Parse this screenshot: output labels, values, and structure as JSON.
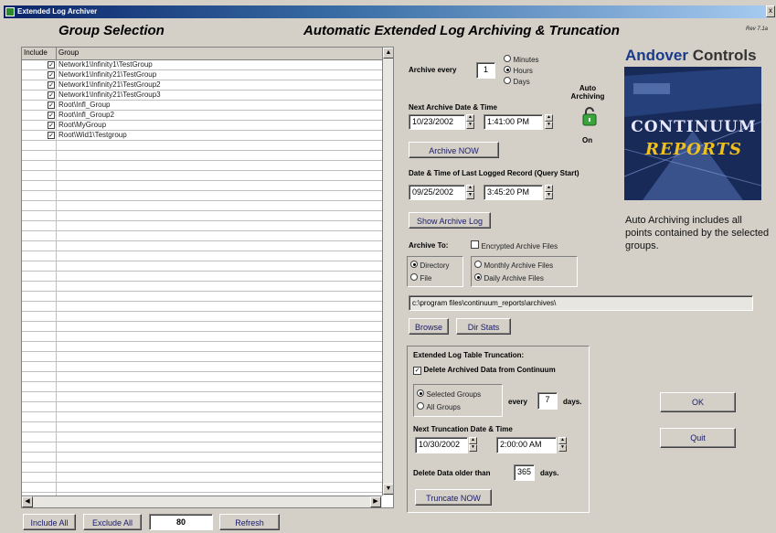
{
  "window": {
    "title": "Extended Log Archiver",
    "close_glyph": "x",
    "version": "Rev 7.1a"
  },
  "headings": {
    "group_selection": "Group Selection",
    "main": "Automatic Extended Log Archiving & Truncation"
  },
  "grid": {
    "col_include": "Include",
    "col_group": "Group",
    "rows": [
      {
        "checked": true,
        "group": "Network1\\Infinity1\\TestGroup"
      },
      {
        "checked": true,
        "group": "Network1\\Infinity21\\TestGroup"
      },
      {
        "checked": true,
        "group": "Network1\\Infinity21\\TestGroup2"
      },
      {
        "checked": true,
        "group": "Network1\\Infinity21\\TestGroup3"
      },
      {
        "checked": true,
        "group": "Root\\Infl_Group"
      },
      {
        "checked": true,
        "group": "Root\\Infl_Group2"
      },
      {
        "checked": true,
        "group": "Root\\MyGroup"
      },
      {
        "checked": true,
        "group": "Root\\Wid1\\Testgroup"
      }
    ]
  },
  "bottom": {
    "include_all": "Include All",
    "exclude_all": "Exclude All",
    "count": "80",
    "refresh": "Refresh"
  },
  "archive": {
    "every_label": "Archive every",
    "every_value": "1",
    "units": [
      {
        "label": "Minutes",
        "selected": false
      },
      {
        "label": "Hours",
        "selected": true
      },
      {
        "label": "Days",
        "selected": false
      }
    ],
    "next_label": "Next Archive Date & Time",
    "next_date": "10/23/2002",
    "next_time": "1:41:00 PM",
    "archive_now": "Archive NOW",
    "auto_label": "Auto Archiving",
    "auto_state": "On",
    "last_label": "Date & Time of Last Logged Record (Query Start)",
    "last_date": "09/25/2002",
    "last_time": "3:45:20 PM",
    "show_log": "Show Archive Log",
    "to_label": "Archive To:",
    "encrypted": "Encrypted Archive Files",
    "directory": "Directory",
    "file": "File",
    "monthly": "Monthly Archive Files",
    "daily": "Daily Archive Files",
    "path": "c:\\program files\\continuum_reports\\archives\\",
    "browse": "Browse",
    "dir_stats": "Dir Stats"
  },
  "truncation": {
    "title": "Extended Log Table Truncation:",
    "delete_label": "Delete Archived Data from Continuum",
    "selected_groups": "Selected Groups",
    "all_groups": "All Groups",
    "every": "every",
    "every_value": "7",
    "days": "days.",
    "next_label": "Next Truncation Date & Time",
    "next_date": "10/30/2002",
    "next_time": "2:00:00 AM",
    "older_label": "Delete Data older than",
    "older_value": "365",
    "older_days": "days.",
    "truncate_now": "Truncate NOW"
  },
  "brand": {
    "andover": "Andover",
    "controls": "Controls",
    "continuum": "CONTINUUM",
    "reports": "REPORTS"
  },
  "note": "Auto Archiving includes all points contained by the selected groups.",
  "buttons": {
    "ok": "OK",
    "quit": "Quit"
  }
}
